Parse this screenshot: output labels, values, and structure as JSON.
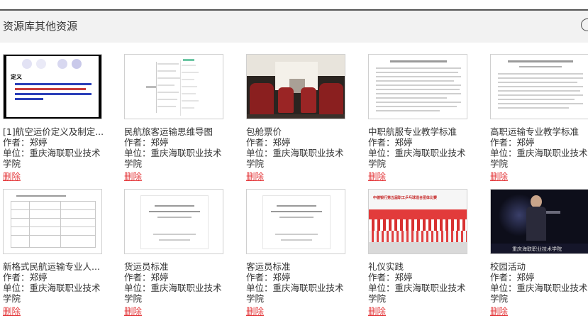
{
  "header": {
    "title": "资源库其他资源"
  },
  "labels": {
    "author": "作者：",
    "unit": "单位：",
    "delete": "删除"
  },
  "items": [
    {
      "title": "[1]航空运价定义及制定...",
      "author": "郑婷",
      "unit": "重庆海联职业技术学院"
    },
    {
      "title": "民航旅客运输思维导图",
      "author": "郑婷",
      "unit": "重庆海联职业技术学院"
    },
    {
      "title": "包舱票价",
      "author": "郑婷",
      "unit": "重庆海联职业技术学院"
    },
    {
      "title": "中职航服专业教学标准",
      "author": "郑婷",
      "unit": "重庆海联职业技术学院"
    },
    {
      "title": "高职运输专业教学标准",
      "author": "郑婷",
      "unit": "重庆海联职业技术学院"
    },
    {
      "title": "新格式民航运输专业人...",
      "author": "郑婷",
      "unit": "重庆海联职业技术学院"
    },
    {
      "title": "货运员标准",
      "author": "郑婷",
      "unit": "重庆海联职业技术学院"
    },
    {
      "title": "客运员标准",
      "author": "郑婷",
      "unit": "重庆海联职业技术学院"
    },
    {
      "title": "礼仪实践",
      "author": "郑婷",
      "unit": "重庆海联职业技术学院"
    },
    {
      "title": "校园活动",
      "author": "郑婷",
      "unit": "重庆海联职业技术学院"
    }
  ],
  "thumbs": {
    "slide_heading": "定义",
    "banner_text": "中德银行第五届职工乒乓球混合团体比赛",
    "school_watermark": "重庆海联职业技术学院"
  }
}
